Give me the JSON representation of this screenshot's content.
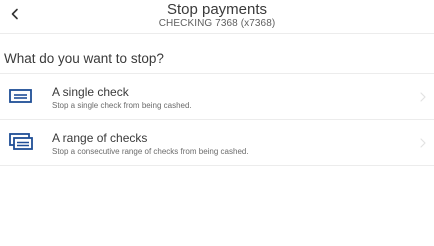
{
  "header": {
    "back_icon": "chevron-left-icon",
    "title": "Stop payments",
    "subtitle": "CHECKING 7368 (x7368)"
  },
  "main": {
    "question": "What do you want to stop?",
    "options": [
      {
        "icon": "single-check-icon",
        "title": "A single check",
        "description": "Stop a single check from being cashed."
      },
      {
        "icon": "range-of-checks-icon",
        "title": "A range of checks",
        "description": "Stop a consecutive range of checks from being cashed."
      }
    ],
    "chevron_icon": "chevron-right-icon"
  },
  "colors": {
    "icon_blue": "#1f4e96",
    "divider": "#ececec",
    "chevron": "#e2e2e2"
  }
}
